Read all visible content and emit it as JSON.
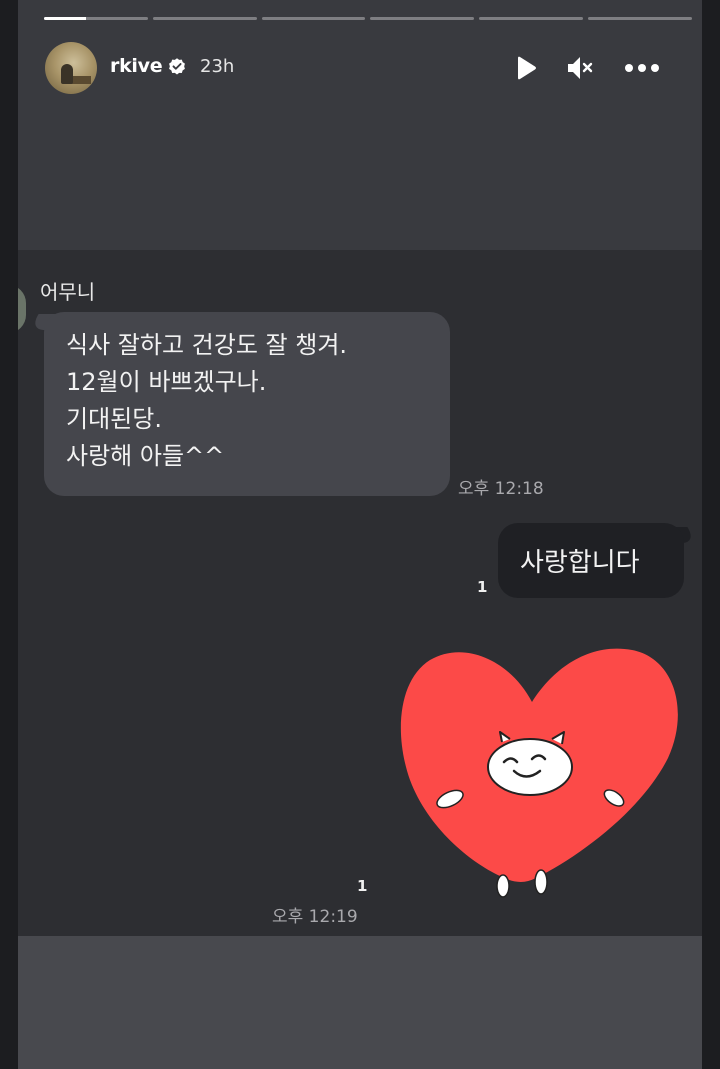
{
  "story": {
    "progress": {
      "segment_count": 6,
      "current_segment_fill": 0.4,
      "bar_color": "#ffffff",
      "track_color": "rgba(255,255,255,0.35)"
    },
    "header": {
      "username": "rkive",
      "verified_icon": "verified-badge-icon",
      "time_ago": "23h",
      "play_icon": "play-icon",
      "mute_icon": "muted-speaker-icon",
      "more_icon": "more-options-icon"
    }
  },
  "chat": {
    "sender_name": "어무니",
    "incoming_message": {
      "lines": [
        "식사 잘하고 건강도 잘 챙겨.",
        "12월이 바쁘겠구나.",
        "기대된당.",
        "사랑해 아들^^"
      ],
      "time": "오후 12:18"
    },
    "outgoing_message": {
      "text": "사랑합니다",
      "unread_count": "1"
    },
    "sticker": {
      "icon": "heart-character-sticker-icon",
      "color": "#fc4a48",
      "unread_count": "1",
      "time": "오후 12:19"
    }
  }
}
